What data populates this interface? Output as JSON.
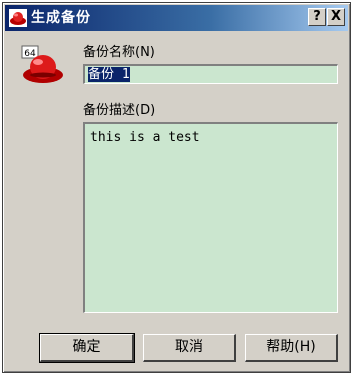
{
  "window": {
    "title": "生成备份",
    "help_button": "?",
    "close_button": "X"
  },
  "app_icon": {
    "badge": "64"
  },
  "form": {
    "name_label": "备份名称(N)",
    "name_value": "备份 1",
    "desc_label": "备份描述(D)",
    "desc_value": "this is a test"
  },
  "buttons": {
    "ok": "确定",
    "cancel": "取消",
    "help": "帮助(H)"
  }
}
